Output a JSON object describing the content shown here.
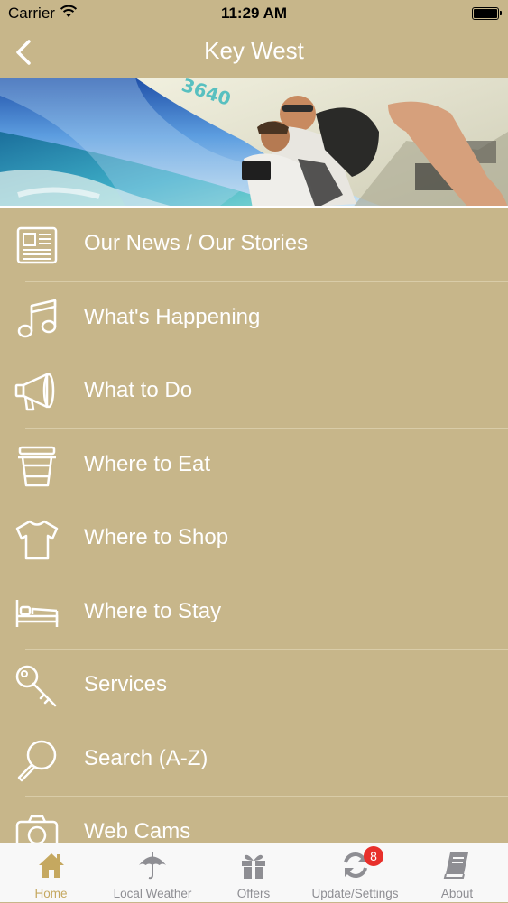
{
  "status_bar": {
    "carrier": "Carrier",
    "time": "11:29 AM"
  },
  "nav": {
    "title": "Key West"
  },
  "banner": {
    "plane_number": "3640"
  },
  "menu": {
    "items": [
      {
        "label": "Our News / Our Stories",
        "icon": "newspaper-icon"
      },
      {
        "label": "What's Happening",
        "icon": "music-note-icon"
      },
      {
        "label": "What to Do",
        "icon": "megaphone-icon"
      },
      {
        "label": "Where to Eat",
        "icon": "coffee-cup-icon"
      },
      {
        "label": "Where to Shop",
        "icon": "tshirt-icon"
      },
      {
        "label": "Where to Stay",
        "icon": "bed-icon"
      },
      {
        "label": "Services",
        "icon": "key-icon"
      },
      {
        "label": "Search (A-Z)",
        "icon": "magnifier-icon"
      },
      {
        "label": "Web Cams",
        "icon": "camera-icon"
      }
    ]
  },
  "tab_bar": {
    "tabs": [
      {
        "label": "Home",
        "icon": "home-icon",
        "active": true
      },
      {
        "label": "Local Weather",
        "icon": "umbrella-icon"
      },
      {
        "label": "Offers",
        "icon": "gift-icon"
      },
      {
        "label": "Update/Settings",
        "icon": "refresh-icon",
        "badge": "8"
      },
      {
        "label": "About",
        "icon": "book-icon"
      }
    ]
  },
  "colors": {
    "background": "#c7b68a",
    "text": "#ffffff",
    "tab_active": "#c5a860",
    "tab_inactive": "#8e8e93",
    "badge": "#e8302b"
  }
}
